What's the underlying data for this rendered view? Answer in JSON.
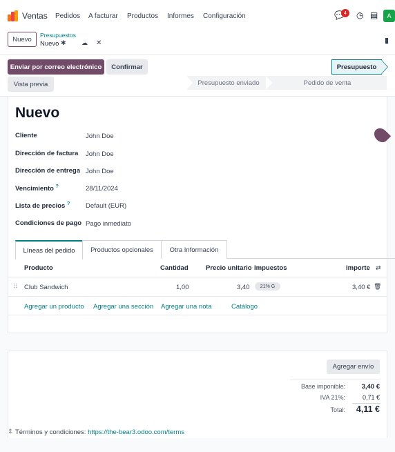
{
  "app": {
    "name": "Ventas"
  },
  "menu": [
    "Pedidos",
    "A facturar",
    "Productos",
    "Informes",
    "Configuración"
  ],
  "systray": {
    "messages_count": "4"
  },
  "breadcrumb": {
    "new_button": "Nuevo",
    "parent": "Presupuestos",
    "current": "Nuevo"
  },
  "actions": {
    "send_email": "Enviar por correo electrónico",
    "confirm": "Confirmar",
    "preview": "Vista previa"
  },
  "statusbar": {
    "stages": [
      "Presupuesto",
      "Presupuesto enviado",
      "Pedido de venta"
    ],
    "active": "Presupuesto"
  },
  "form": {
    "title": "Nuevo",
    "fields": [
      {
        "label": "Cliente",
        "value": "John Doe",
        "help": ""
      },
      {
        "label": "Dirección de factura",
        "value": "John Doe",
        "help": ""
      },
      {
        "label": "Dirección de entrega",
        "value": "John Doe",
        "help": ""
      },
      {
        "label": "Vencimiento",
        "value": "28/11/2024",
        "help": "?"
      },
      {
        "label": "Lista de precios",
        "value": "Default (EUR)",
        "help": "?"
      },
      {
        "label": "Condiciones de pago",
        "value": "Pago inmediato",
        "help": ""
      }
    ]
  },
  "tabs": [
    "Líneas del pedido",
    "Productos opcionales",
    "Otra Información"
  ],
  "table": {
    "columns": [
      "Producto",
      "Cantidad",
      "Precio unitario",
      "Impuestos",
      "Importe"
    ],
    "rows": [
      {
        "product": "Club Sandwich",
        "quantity": "1,00",
        "unit_price": "3,40",
        "taxes": "21% G",
        "amount": "3,40 €"
      }
    ],
    "add_links": [
      "Agregar un producto",
      "Agregar una sección",
      "Agregar una nota",
      "Catálogo"
    ]
  },
  "totals": {
    "add_shipping": "Agregar envío",
    "base_label": "Base imponible:",
    "base_value": "3,40 €",
    "tax_label": "IVA 21%:",
    "tax_value": "0,71 €",
    "total_label": "Total:",
    "total_value": "4,11 €"
  },
  "terms": {
    "label": "Términos y condiciones:",
    "link": "https://the-bear3.odoo.com/terms"
  }
}
